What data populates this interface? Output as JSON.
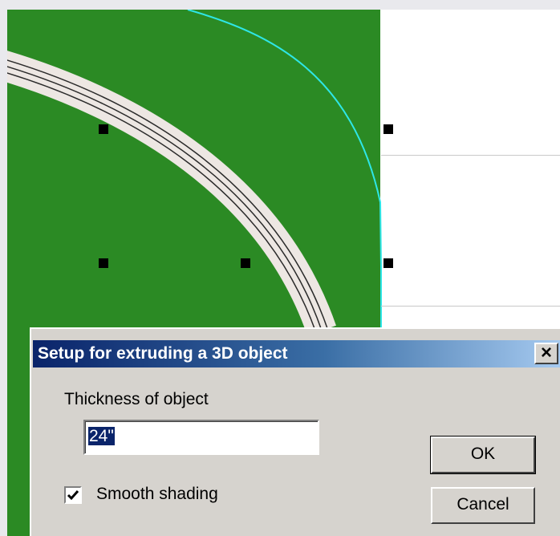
{
  "dialog": {
    "title": "Setup for extruding a 3D object",
    "close_glyph": "✕",
    "thickness_label": "Thickness of object",
    "thickness_value": "24\"",
    "smooth_shading_label": "Smooth shading",
    "smooth_shading_checked": true,
    "ok_label": "OK",
    "cancel_label": "Cancel"
  },
  "drawing": {
    "background_color": "#2b8a24",
    "road_color": "#ede7e3",
    "boundary_color": "#2ee6e6",
    "handle_color": "#000000"
  }
}
